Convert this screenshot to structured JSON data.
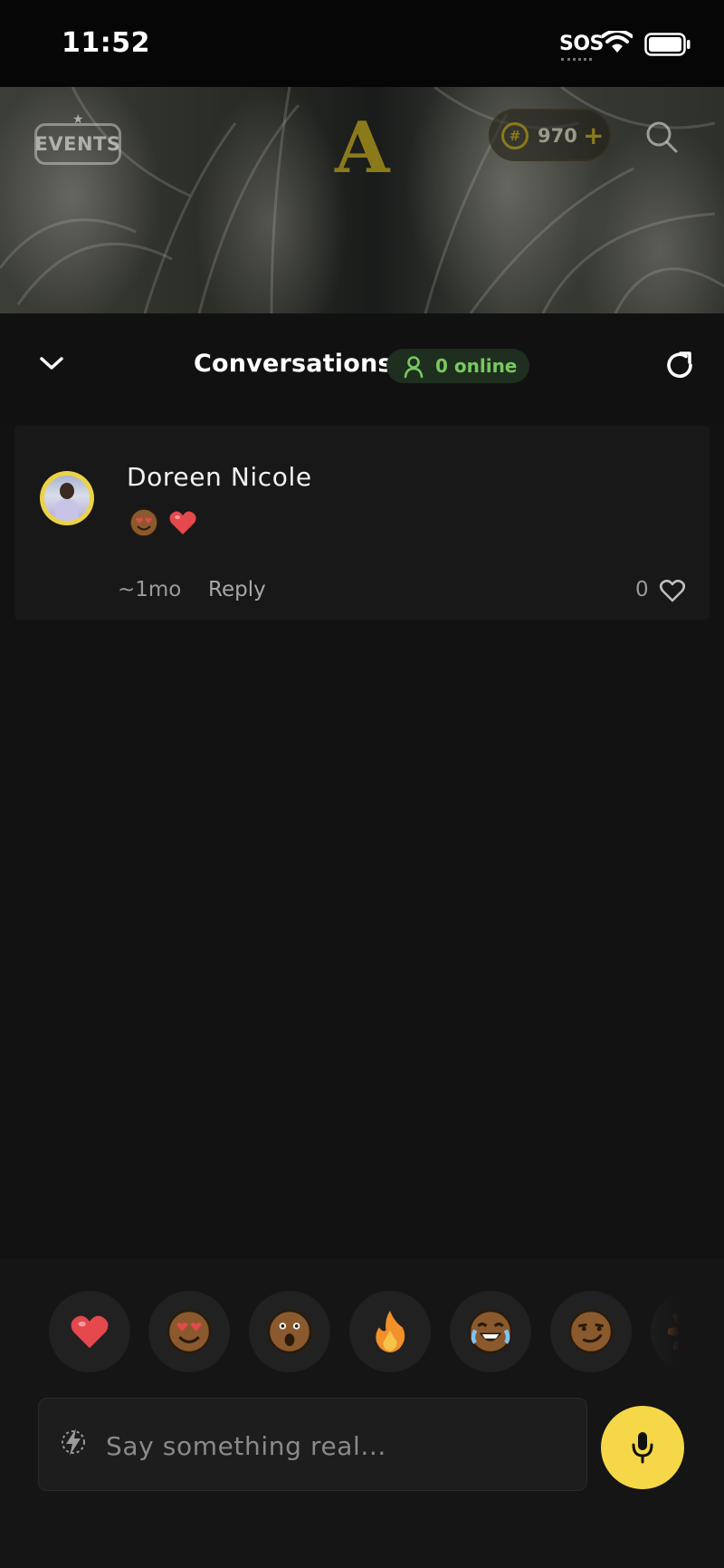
{
  "status_bar": {
    "time": "11:52",
    "network": "SOS"
  },
  "hero": {
    "events_label": "EVENTS",
    "logo_letter": "A",
    "coins": "970",
    "coins_add": "+"
  },
  "header": {
    "title": "Conversations",
    "online_label": "0 online"
  },
  "comments": [
    {
      "author": "Doreen Nicole",
      "body_emojis": [
        "heart-eyes-emoji",
        "red-heart-emoji"
      ],
      "time": "~1mo",
      "reply_label": "Reply",
      "likes": "0"
    }
  ],
  "reactions": [
    "red-heart",
    "heart-eyes",
    "surprised",
    "fire",
    "tears-of-joy",
    "smirk",
    "sunflower"
  ],
  "composer": {
    "placeholder": "Say something real...",
    "value": ""
  },
  "colors": {
    "background": "#121212",
    "accent_yellow": "#f6d748",
    "online_green": "#78c860",
    "heart_red": "#e5484d"
  }
}
